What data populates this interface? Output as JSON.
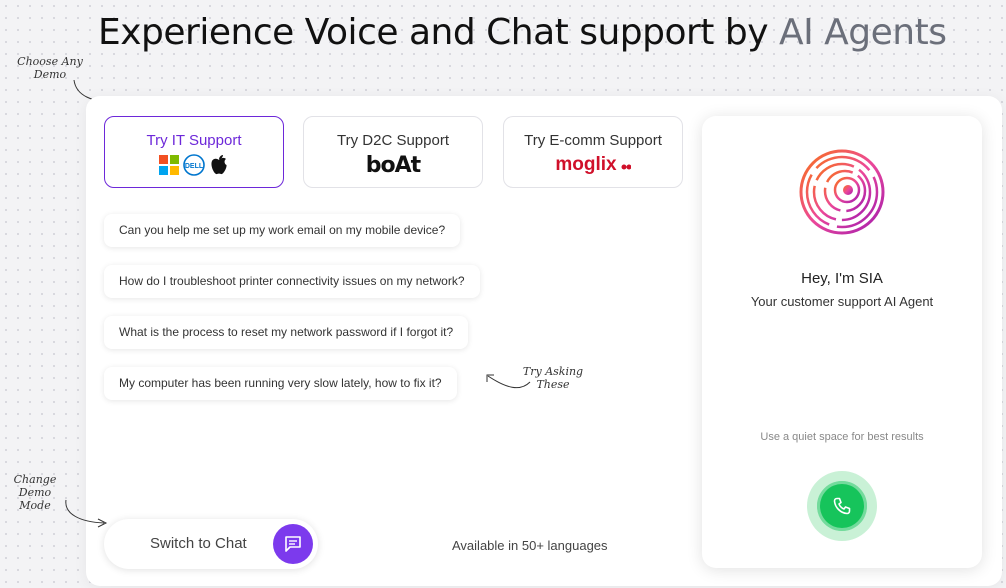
{
  "header": {
    "title_main": "Experience Voice and Chat support by ",
    "title_accent": "AI Agents"
  },
  "annotations": {
    "choose_demo_line1": "Choose Any",
    "choose_demo_line2": "Demo",
    "try_asking_line1": "Try Asking",
    "try_asking_line2": "These",
    "change_mode_line1": "Change",
    "change_mode_line2": "Demo Mode"
  },
  "demos": [
    {
      "label": "Try IT Support",
      "brands": [
        "microsoft-logo",
        "dell-logo",
        "apple-logo"
      ],
      "active": true
    },
    {
      "label": "Try D2C Support",
      "brand_text": "boAt",
      "active": false
    },
    {
      "label": "Try E-comm Support",
      "brand_text": "moglix",
      "active": false
    }
  ],
  "questions": [
    "Can you help me set up my work email on my mobile device?",
    "How do I troubleshoot printer connectivity issues on my network?",
    "What is the process to reset my network password if I forgot it?",
    "My computer has been running very slow lately, how to fix it?"
  ],
  "footer": {
    "switch_label": "Switch to Chat",
    "languages": "Available in 50+ languages"
  },
  "agent": {
    "greeting": "Hey, I'm SIA",
    "subtitle": "Your customer support AI Agent",
    "hint": "Use a quiet space for best results",
    "call_icon": "phone-icon"
  },
  "colors": {
    "accent_purple": "#6d28d9",
    "chat_button": "#7c3aed",
    "call_green": "#16c45b",
    "call_halo": "#c9f1d6",
    "moglix_red": "#d0102a"
  }
}
